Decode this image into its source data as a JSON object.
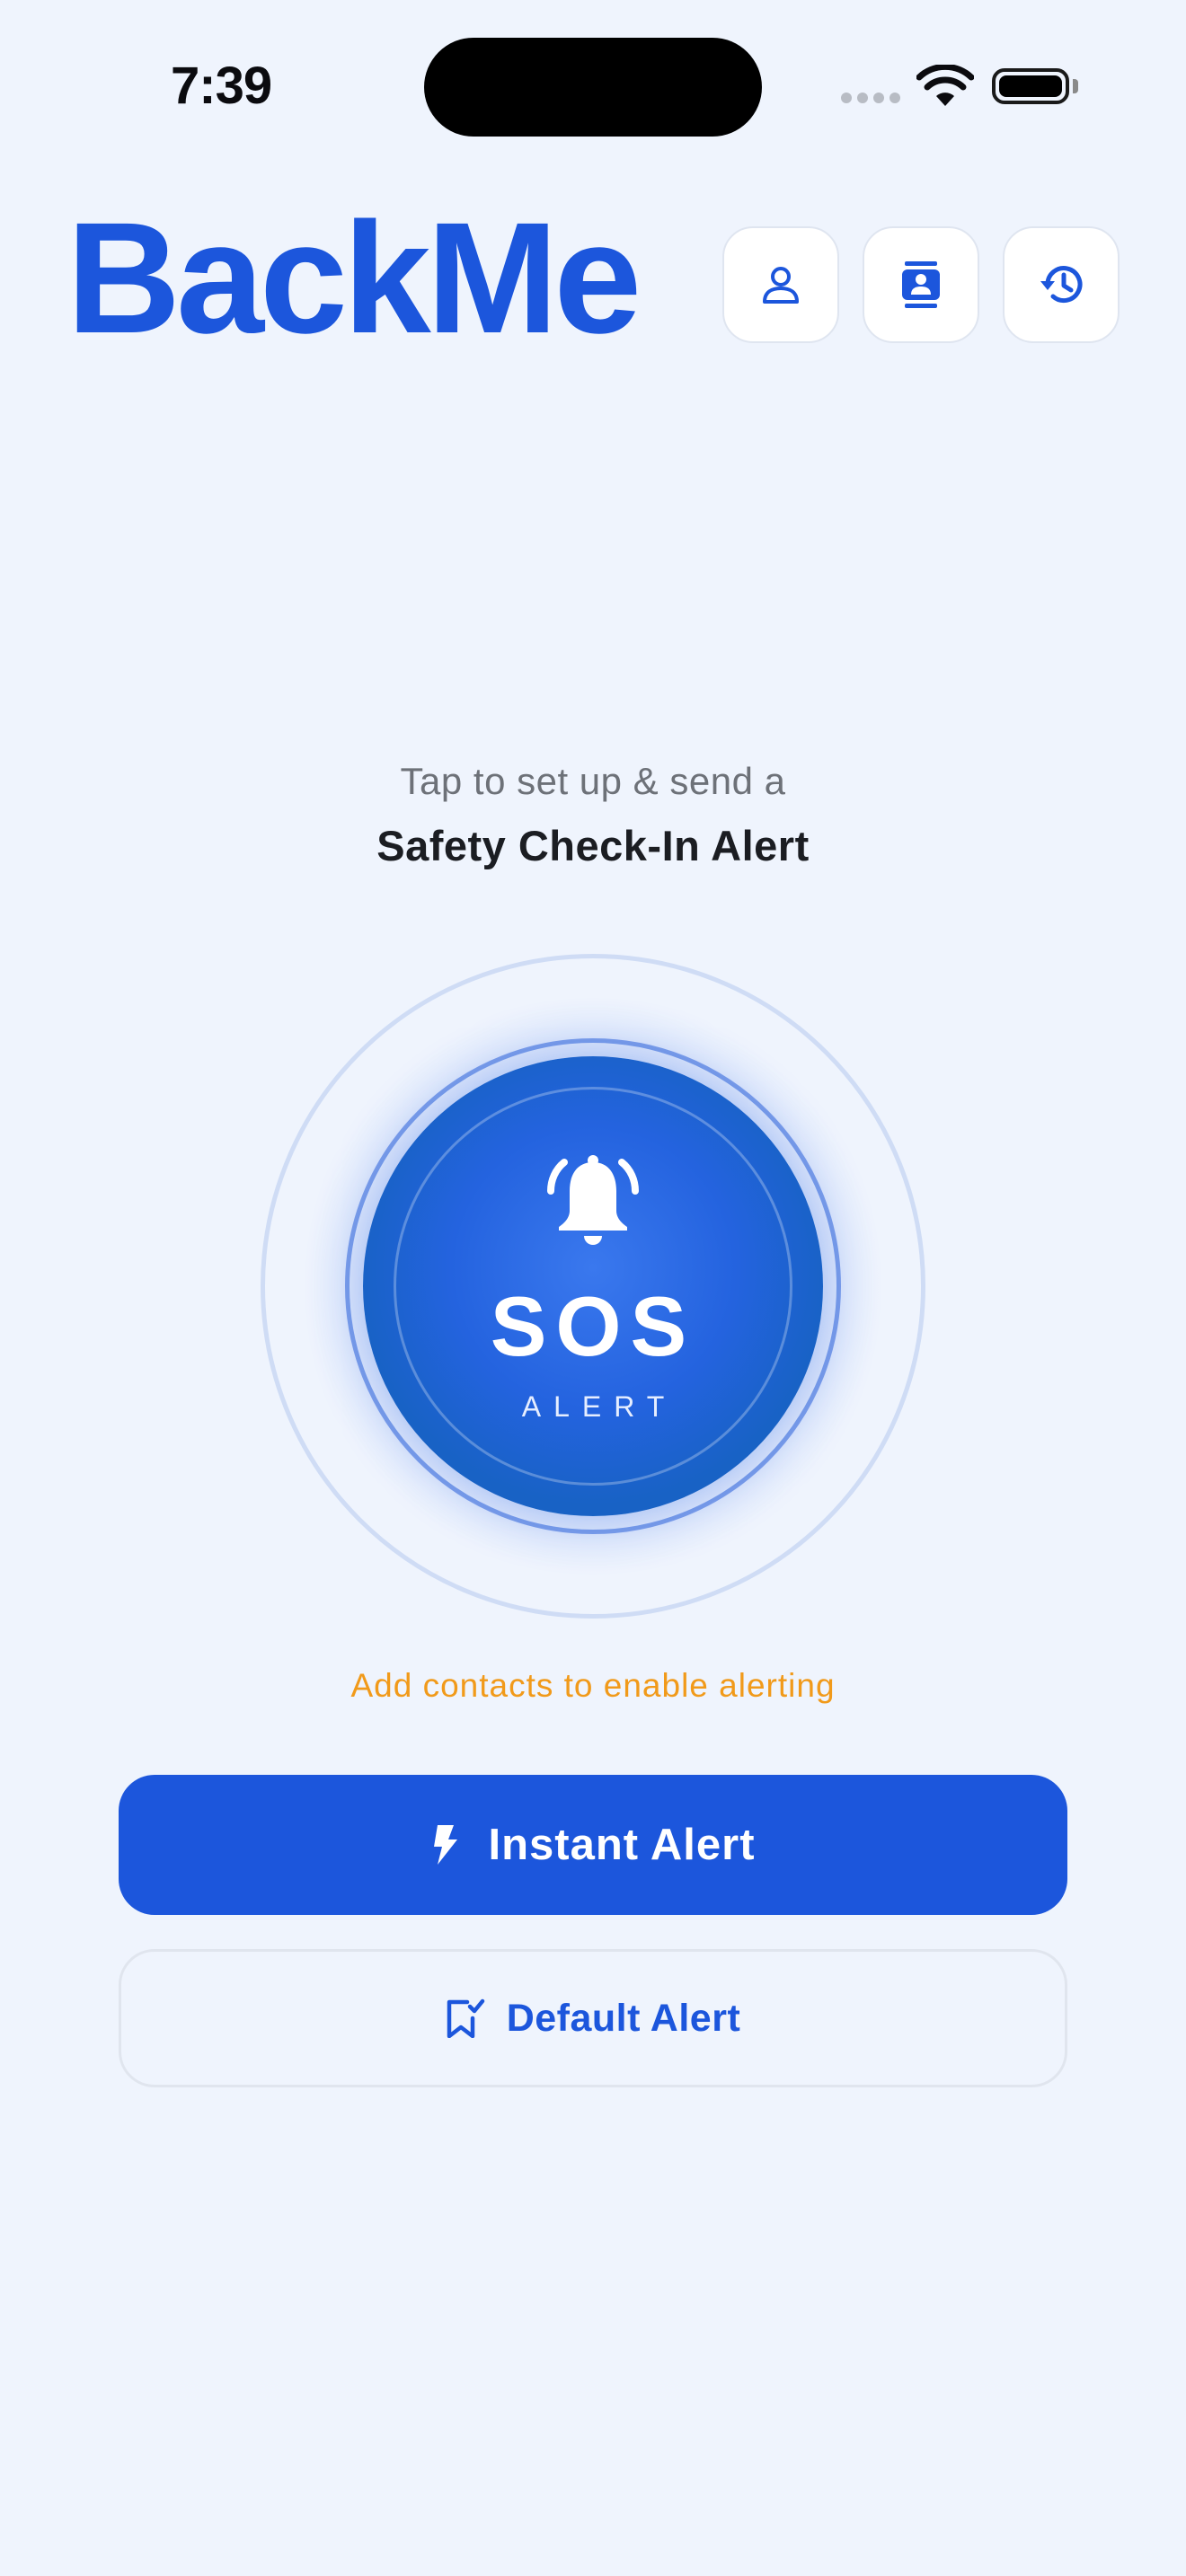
{
  "status_bar": {
    "time": "7:39"
  },
  "header": {
    "title": "BackMe",
    "buttons": [
      {
        "icon": "person-icon"
      },
      {
        "icon": "contact-book-icon"
      },
      {
        "icon": "history-icon"
      }
    ]
  },
  "prompt": {
    "subtitle": "Tap to set up & send a",
    "title": "Safety Check-In Alert"
  },
  "sos": {
    "icon": "bell-icon",
    "label": "SOS",
    "sublabel": "ALERT"
  },
  "warning": "Add contacts to enable alerting",
  "actions": {
    "instant": {
      "label": "Instant Alert",
      "icon": "bolt-icon"
    },
    "default": {
      "label": "Default Alert",
      "icon": "bookmark-check-icon"
    }
  },
  "colors": {
    "background": "#eff4fd",
    "primary": "#1c56dc",
    "warning": "#f19a1a"
  }
}
